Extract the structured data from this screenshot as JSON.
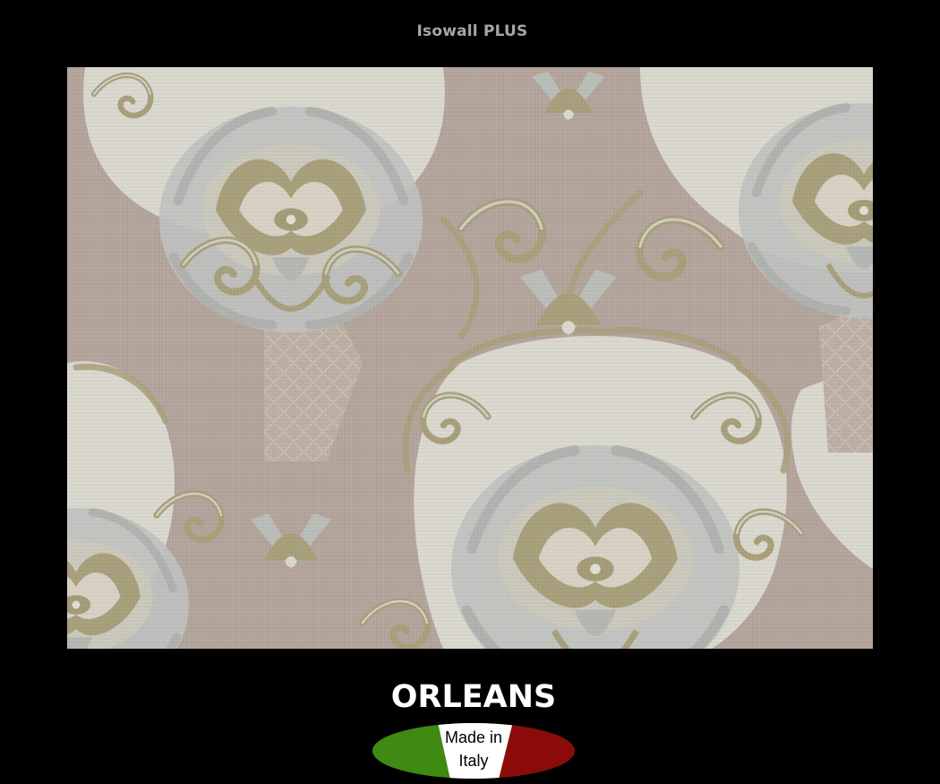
{
  "header": {
    "title": "Isowall PLUS"
  },
  "swatch": {
    "pattern": "damask",
    "colors": {
      "background": "#cfc7bd",
      "mauve": "#b3a49a",
      "cream": "#d8d6cc",
      "silver": "#b9bcba",
      "gold": "#a39b73"
    }
  },
  "product": {
    "name": "ORLEANS"
  },
  "origin_badge": {
    "line1": "Made in",
    "line2": "Italy",
    "colors": {
      "green": "#3f8a12",
      "white": "#ffffff",
      "red": "#8b0a0a"
    }
  }
}
